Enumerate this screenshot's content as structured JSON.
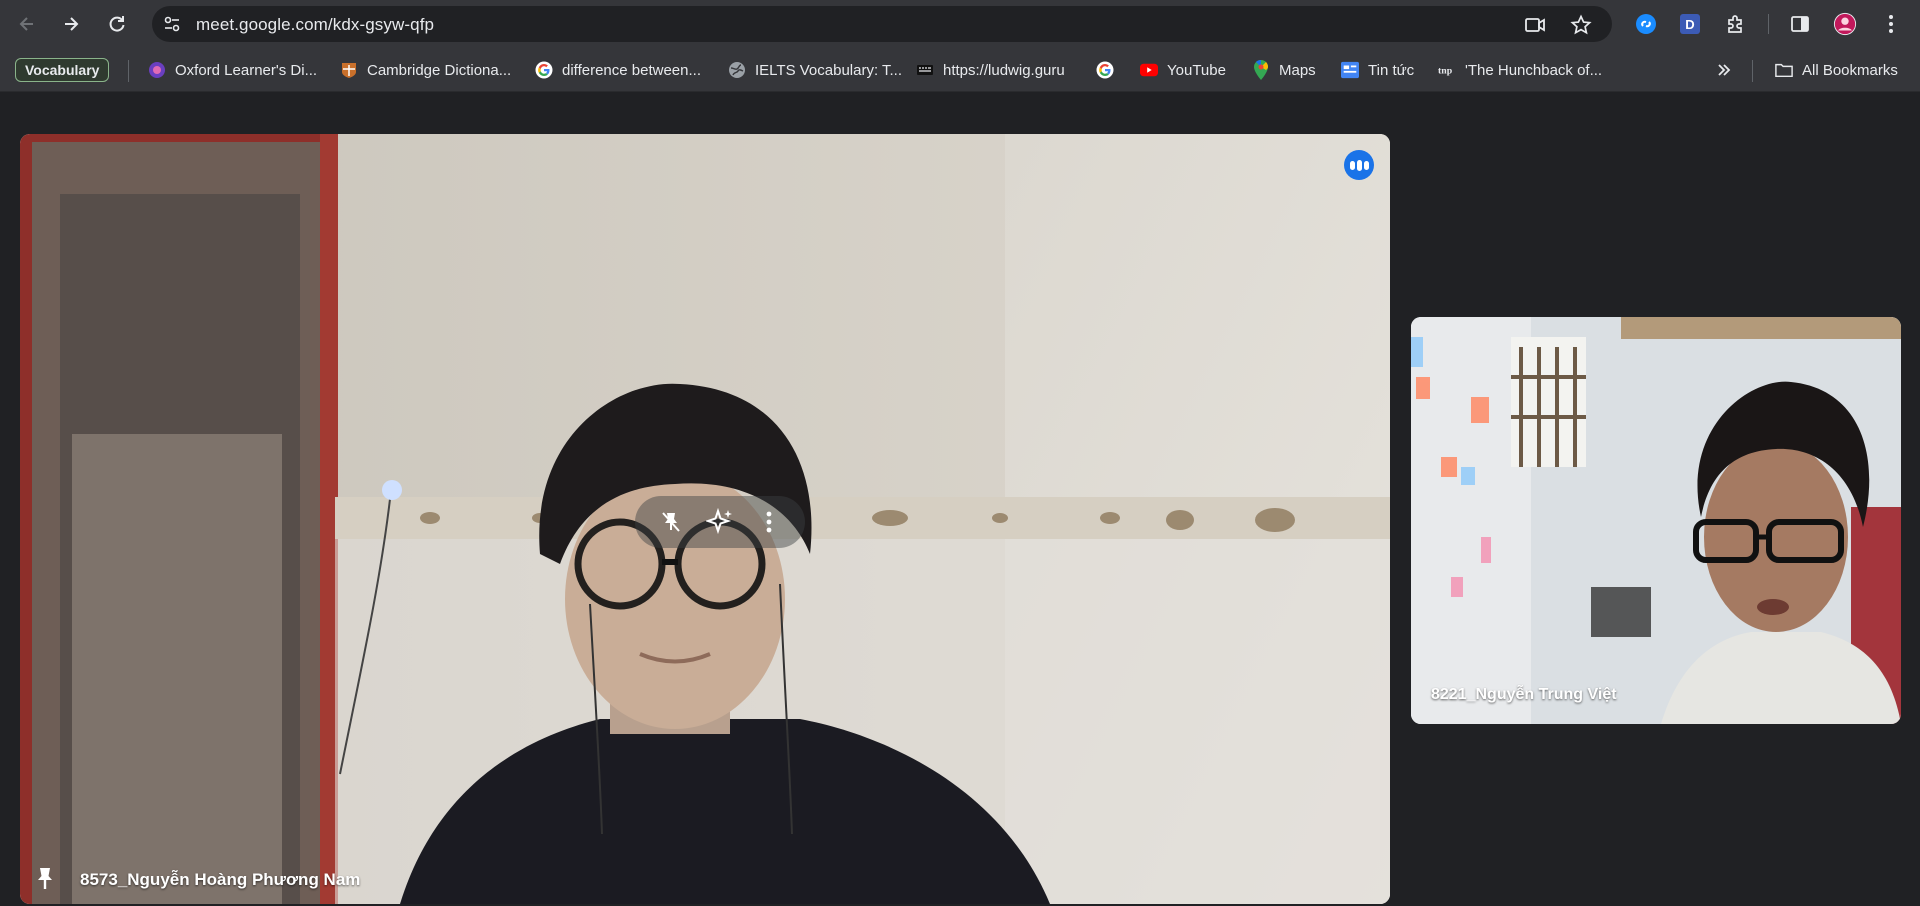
{
  "browser": {
    "url": "meet.google.com/kdx-gsyw-qfp",
    "extension_letter": "D"
  },
  "bookmarks": {
    "vocabulary_label": "Vocabulary",
    "items": [
      {
        "label": "Oxford Learner's Di...",
        "icon": "oxford-icon"
      },
      {
        "label": "Cambridge Dictiona...",
        "icon": "cambridge-icon"
      },
      {
        "label": "difference between...",
        "icon": "google-icon"
      },
      {
        "label": "IELTS Vocabulary: T...",
        "icon": "globe-icon"
      },
      {
        "label": "https://ludwig.guru",
        "icon": "ludwig-icon"
      },
      {
        "label": "",
        "icon": "google-icon"
      },
      {
        "label": "YouTube",
        "icon": "youtube-icon"
      },
      {
        "label": "Maps",
        "icon": "maps-icon"
      },
      {
        "label": "Tin tức",
        "icon": "news-icon"
      },
      {
        "label": "'The Hunchback of...",
        "icon": "tnp-icon"
      }
    ],
    "all_bookmarks_label": "All Bookmarks"
  },
  "meet": {
    "main_participant": "8573_Nguyễn Hoàng Phương Nam",
    "side_participant": "8221_Nguyễn Trung Việt"
  },
  "colors": {
    "toolbar_bg": "#35363a",
    "omnibox_bg": "#202124",
    "meet_bg": "#202124",
    "speaking_blue": "#1a73e8"
  }
}
